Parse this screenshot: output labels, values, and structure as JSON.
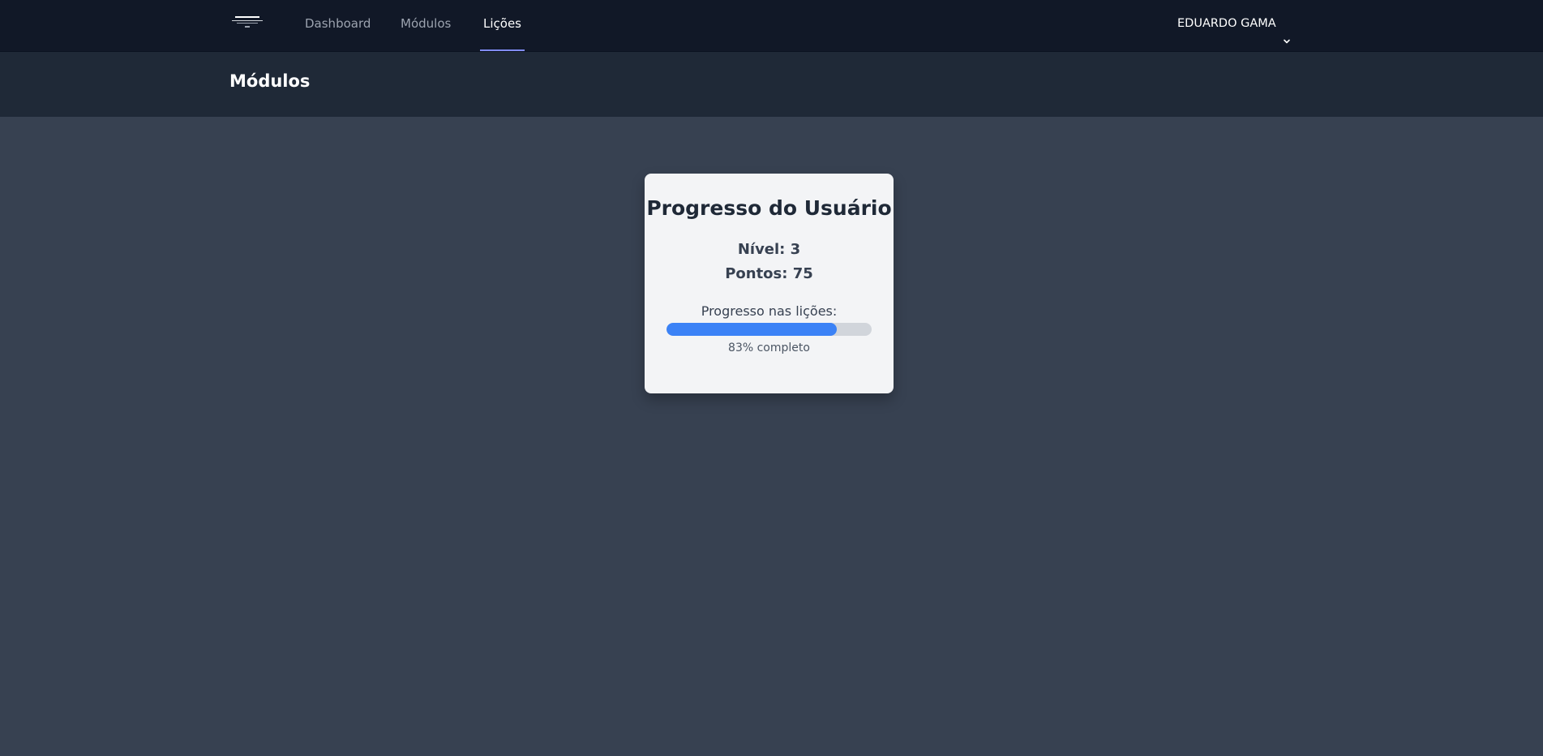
{
  "nav": {
    "logo": "logo-icon",
    "links": [
      {
        "label": "Dashboard"
      },
      {
        "label": "Módulos"
      },
      {
        "label": "Lições",
        "active": true
      }
    ],
    "user": {
      "name": "EDUARDO GAMA",
      "icon": "chevron-down-icon"
    }
  },
  "header": {
    "title": "Módulos"
  },
  "card": {
    "title": "Progresso do Usuário",
    "level": "Nível: 3",
    "points": "Pontos: 75",
    "progress_label": "Progresso nas lições:",
    "progress_fraction": 0.83,
    "progress_text": "83% completo"
  },
  "colors": {
    "accent": "#3b82f6",
    "nav_active_underline": "#818cf8",
    "nav_bg": "#111827",
    "header_bg": "#1f2937",
    "page_bg": "#374151"
  }
}
